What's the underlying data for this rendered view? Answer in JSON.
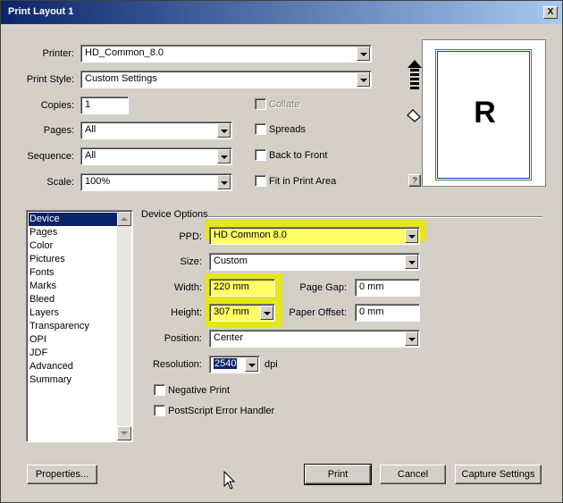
{
  "window": {
    "title": "Print Layout 1",
    "close_glyph": "X"
  },
  "left": {
    "printer_label": "Printer:",
    "printer_value": "HD_Common_8.0",
    "print_style_label": "Print Style:",
    "print_style_value": "Custom Settings",
    "copies_label": "Copies:",
    "copies_value": "1",
    "pages_label": "Pages:",
    "pages_value": "All",
    "sequence_label": "Sequence:",
    "sequence_value": "All",
    "scale_label": "Scale:",
    "scale_value": "100%"
  },
  "checks": {
    "collate": "Collate",
    "spreads": "Spreads",
    "back_to_front": "Back to Front",
    "fit_in_print_area": "Fit in Print Area"
  },
  "preview": {
    "letter": "R",
    "help_glyph": "?"
  },
  "sidebar": {
    "items": [
      "Device",
      "Pages",
      "Color",
      "Pictures",
      "Fonts",
      "Marks",
      "Bleed",
      "Layers",
      "Transparency",
      "OPI",
      "JDF",
      "Advanced",
      "Summary"
    ],
    "selected": "Device"
  },
  "device": {
    "section_title": "Device Options",
    "ppd_label": "PPD:",
    "ppd_value": "HD Common 8.0",
    "size_label": "Size:",
    "size_value": "Custom",
    "width_label": "Width:",
    "width_value": "220 mm",
    "height_label": "Height:",
    "height_value": "307 mm",
    "page_gap_label": "Page Gap:",
    "page_gap_value": "0 mm",
    "paper_offset_label": "Paper Offset:",
    "paper_offset_value": "0 mm",
    "position_label": "Position:",
    "position_value": "Center",
    "resolution_label": "Resolution:",
    "resolution_value": "2540",
    "resolution_unit": "dpi",
    "negative_print": "Negative Print",
    "postscript_error": "PostScript Error Handler"
  },
  "buttons": {
    "properties": "Properties...",
    "print": "Print",
    "cancel": "Cancel",
    "capture": "Capture Settings"
  },
  "colors": {
    "highlight": "#e6e61a",
    "field_highlight": "#ffff66",
    "titlebar": "#0a246a",
    "selection": "#0a246a"
  }
}
